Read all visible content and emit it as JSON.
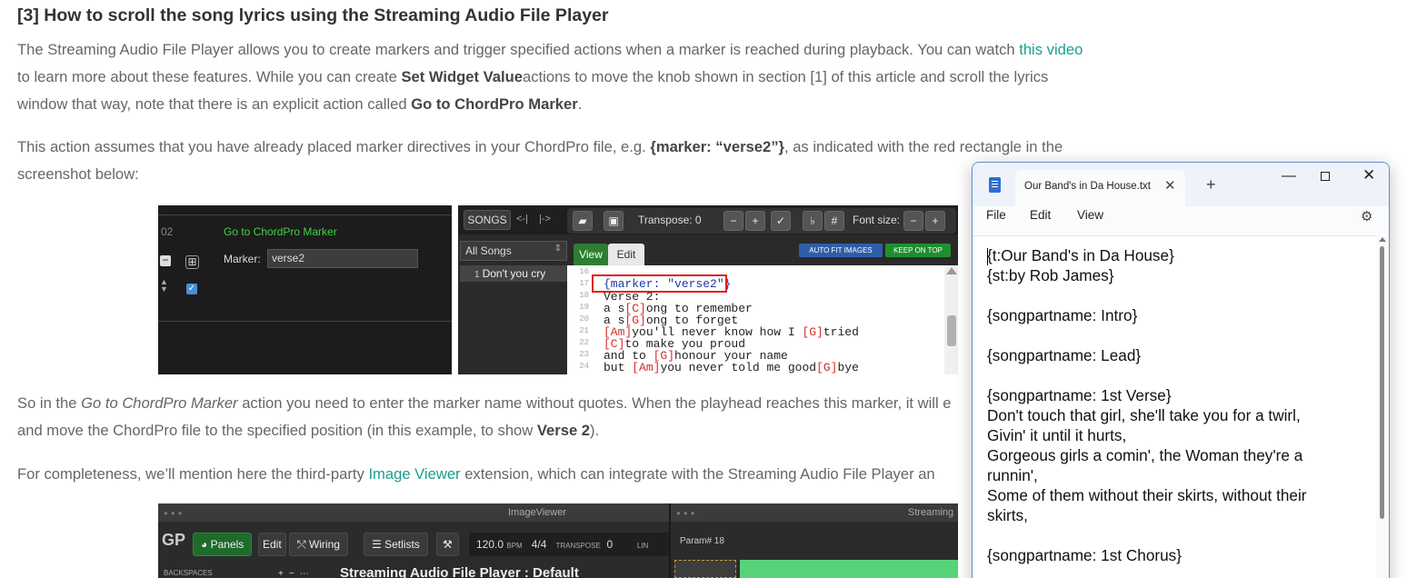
{
  "article": {
    "heading": "[3] How to scroll the song lyrics using the Streaming Audio File Player",
    "p1": {
      "t1": "The Streaming Audio File Player allows you to create markers and trigger specified actions when a marker is reached during playback. You can watch ",
      "link1": "this video",
      "t2": " to learn more about these features. While you can create ",
      "b1": "Set Widget Value",
      "t3": "actions to move the knob shown in section [1] of this article and scroll the lyrics window that way, note that there is an explicit action called ",
      "b2": "Go to ChordPro Marker",
      "t4": "."
    },
    "p2": {
      "t1": "This action assumes that you have already placed marker directives in your ChordPro file, e.g. ",
      "b1": "{marker: “verse2”}",
      "t2": ", as indicated with the red rectangle in the screenshot below:"
    },
    "p3": {
      "t1": "So in the ",
      "i1": "Go to ChordPro Marker",
      "t2": " action you need to enter the marker name without quotes. When the playhead reaches this marker, it will e",
      "t3": "and move the ChordPro file to the specified position (in this example, to show ",
      "b1": "Verse 2",
      "t4": ")."
    },
    "p4": {
      "t1": "For completeness, we’ll mention here the third-party ",
      "link1": "Image Viewer",
      "t2": " extension, which can integrate with the Streaming Audio File Player an"
    }
  },
  "shot1": {
    "num": "02",
    "action_title": "Go to ChordPro Marker",
    "marker_label": "Marker:",
    "marker_value": "verse2"
  },
  "shot2": {
    "songs": "SONGS",
    "nav1": "<-|",
    "nav2": "|->",
    "transpose": "Transpose: 0",
    "flat": "♭",
    "sharp": "#",
    "font_size": "Font size:",
    "all_songs": "All Songs",
    "song_num": "1",
    "song_name": "Don't you cry",
    "tab_view": "View",
    "tab_edit": "Edit",
    "auto_fit": "AUTO FIT IMAGES",
    "keep_on_top": "KEEP ON TOP",
    "line_numbers": [
      "16",
      "17",
      "18",
      "19",
      "20",
      "21",
      "22",
      "23",
      "24"
    ],
    "marker_line": "{marker: \"verse2\"}",
    "lines": [
      {
        "parts": [
          {
            "t": "Verse 2:",
            "k": "n"
          }
        ]
      },
      {
        "parts": [
          {
            "t": "a s",
            "k": "n"
          },
          {
            "t": "[C]",
            "k": "c"
          },
          {
            "t": "ong to remember",
            "k": "n"
          }
        ]
      },
      {
        "parts": [
          {
            "t": "a s",
            "k": "n"
          },
          {
            "t": "[G]",
            "k": "c"
          },
          {
            "t": "ong to forget",
            "k": "n"
          }
        ]
      },
      {
        "parts": [
          {
            "t": "[Am]",
            "k": "c"
          },
          {
            "t": "you'll never know how I ",
            "k": "n"
          },
          {
            "t": "[G]",
            "k": "c"
          },
          {
            "t": "tried",
            "k": "n"
          }
        ]
      },
      {
        "parts": [
          {
            "t": "[C]",
            "k": "c"
          },
          {
            "t": "to make you proud",
            "k": "n"
          }
        ]
      },
      {
        "parts": [
          {
            "t": "and to ",
            "k": "n"
          },
          {
            "t": "[G]",
            "k": "c"
          },
          {
            "t": "honour your name",
            "k": "n"
          }
        ]
      },
      {
        "parts": [
          {
            "t": "but ",
            "k": "n"
          },
          {
            "t": "[Am]",
            "k": "c"
          },
          {
            "t": "you never told me good",
            "k": "n"
          },
          {
            "t": "[G]",
            "k": "c"
          },
          {
            "t": "bye",
            "k": "n"
          }
        ]
      }
    ]
  },
  "shot3": {
    "title_left": "ImageViewer",
    "title_right": "Streaming",
    "logo": "GP",
    "panels": "Panels",
    "edit": "Edit",
    "wiring": "Wiring",
    "setlists": "Setlists",
    "bpm": "120.0",
    "bpm_unit": "BPM",
    "time_sig": "4/4",
    "transpose": "TRANSPOSE",
    "transpose_val": "0",
    "lin": "LIN",
    "param": "Param# 18",
    "backspaces": "BACKSPACES",
    "stream_title": "Streaming Audio File Player : Default"
  },
  "notepad": {
    "tab_title": "Our Band's in Da House.txt",
    "menu": [
      "File",
      "Edit",
      "View"
    ],
    "lines": [
      "{t:Our Band's in Da House}",
      "{st:by Rob James}",
      "",
      "{songpartname: Intro}",
      "",
      "{songpartname: Lead}",
      "",
      "{songpartname: 1st Verse}",
      "Don't touch that girl, she'll take you for a twirl,",
      "Givin' it until it hurts,",
      "Gorgeous girls a comin', the Woman they're a",
      "runnin',",
      "Some of them without their skirts, without their",
      "skirts,",
      "",
      "{songpartname: 1st Chorus}"
    ]
  }
}
